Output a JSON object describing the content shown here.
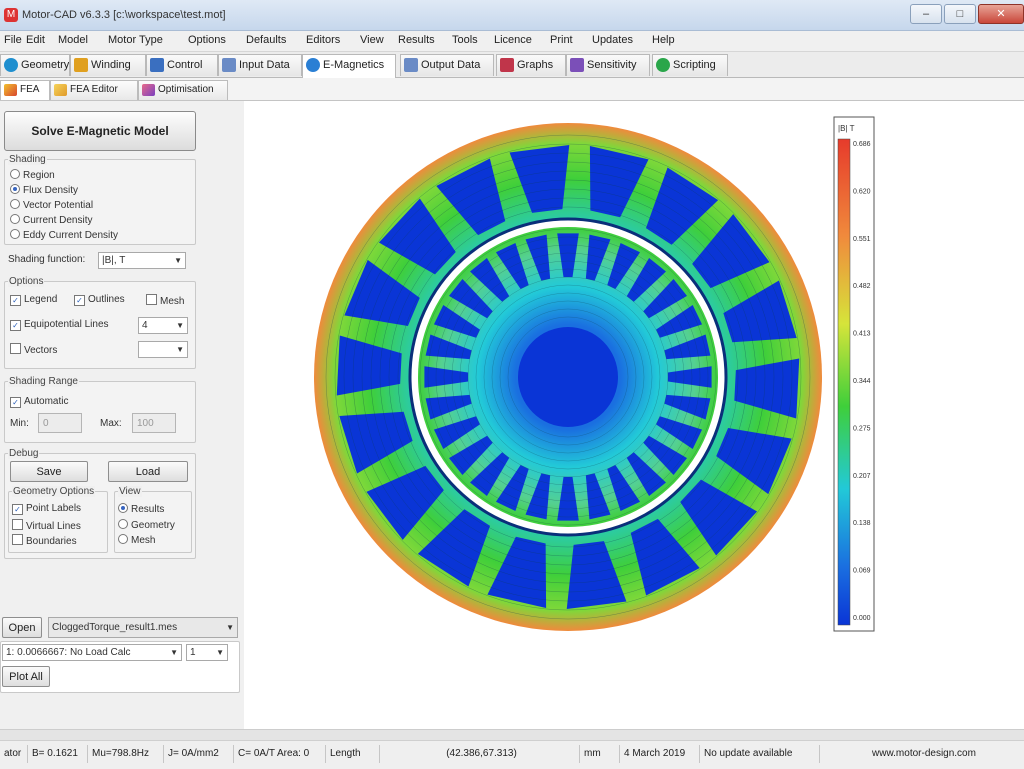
{
  "window": {
    "title": "Motor-CAD v6.3.3 [c:\\workspace\\test.mot]",
    "min_glyph": "–",
    "max_glyph": "□",
    "close_glyph": "✕"
  },
  "menu": [
    "File",
    "Edit",
    "Model",
    "Motor Type",
    "Options",
    "Defaults",
    "Editors",
    "View",
    "Results",
    "Tools",
    "Licence",
    "Print",
    "Updates",
    "Help"
  ],
  "main_tabs": [
    {
      "label": "Geometry",
      "icon_color": "#1f8fcf"
    },
    {
      "label": "Winding",
      "icon_color": "#e0a020"
    },
    {
      "label": "Control",
      "icon_color": "#3a6fc0"
    },
    {
      "label": "Input Data",
      "icon_color": "#6a8bc6"
    },
    {
      "label": "E-Magnetics",
      "icon_color": "#2a7fd4"
    },
    {
      "label": "Output Data",
      "icon_color": "#6a8bc6"
    },
    {
      "label": "Graphs",
      "icon_color": "#c0354a"
    },
    {
      "label": "Sensitivity",
      "icon_color": "#7b4fb8"
    },
    {
      "label": "Scripting",
      "icon_color": "#2aa64a"
    }
  ],
  "sub_tabs": [
    {
      "label": "FEA",
      "icon_color": "#d8462e"
    },
    {
      "label": "FEA Editor",
      "icon_color": "#e09a2a"
    },
    {
      "label": "Optimisation",
      "icon_color": "#c84066"
    }
  ],
  "panel": {
    "solve_button": "Solve E-Magnetic Model",
    "shading": {
      "label": "Shading",
      "options": [
        "Region",
        "Flux Density",
        "Vector Potential",
        "Current Density",
        "Eddy Current Density"
      ],
      "selected": 1
    },
    "shading_function": {
      "label": "Shading function:",
      "value": "|B|, T"
    },
    "options": {
      "label": "Options",
      "legend": "Legend",
      "outlines": "Outlines",
      "mesh": "Mesh",
      "equipotential": "Equipotential Lines",
      "equipotential_count": "4",
      "vectors": "Vectors",
      "vectors_value": ""
    },
    "shading_range": {
      "label": "Shading Range",
      "automatic": "Automatic",
      "min_label": "Min:",
      "min_value": "0",
      "max_label": "Max:",
      "max_value": "100"
    },
    "debug": {
      "label": "Debug",
      "save": "Save",
      "load": "Load",
      "geometry_options_label": "Geometry Options",
      "point_labels": "Point Labels",
      "virtual_lines": "Virtual Lines",
      "boundaries": "Boundaries",
      "view_label": "View",
      "view_options": [
        "Results",
        "Geometry",
        "Mesh"
      ],
      "view_selected": 0
    },
    "open_button": "Open",
    "result_file": "CloggedTorque_result1.mes",
    "load_case": "1: 0.0066667: No Load Calc",
    "load_case_num": "1",
    "plot_button": "Plot All"
  },
  "legend": {
    "title": "|B| T",
    "ticks": [
      "0.686",
      "0.620",
      "0.551",
      "0.482",
      "0.413",
      "0.344",
      "0.275",
      "0.207",
      "0.138",
      "0.069",
      "0.000"
    ]
  },
  "colors": {
    "steel_blue": "#0a35d6",
    "field_cyan": "#22c9d8",
    "field_green": "#3fcf3a",
    "field_yellow": "#d6e43a",
    "field_orange": "#f08a3c",
    "field_red": "#e63b2b"
  },
  "status": {
    "seg1": "ator",
    "seg2": "B= 0.1621",
    "seg3": "Mu=798.8Hz",
    "seg4": "J= 0A/mm2",
    "seg5": "C= 0A/T Area: 0",
    "seg6": "Length",
    "seg7": "(42.386,67.313)",
    "seg8": "mm",
    "seg9": "4 March 2019",
    "seg10": "No update available",
    "seg11": "www.motor-design.com"
  }
}
